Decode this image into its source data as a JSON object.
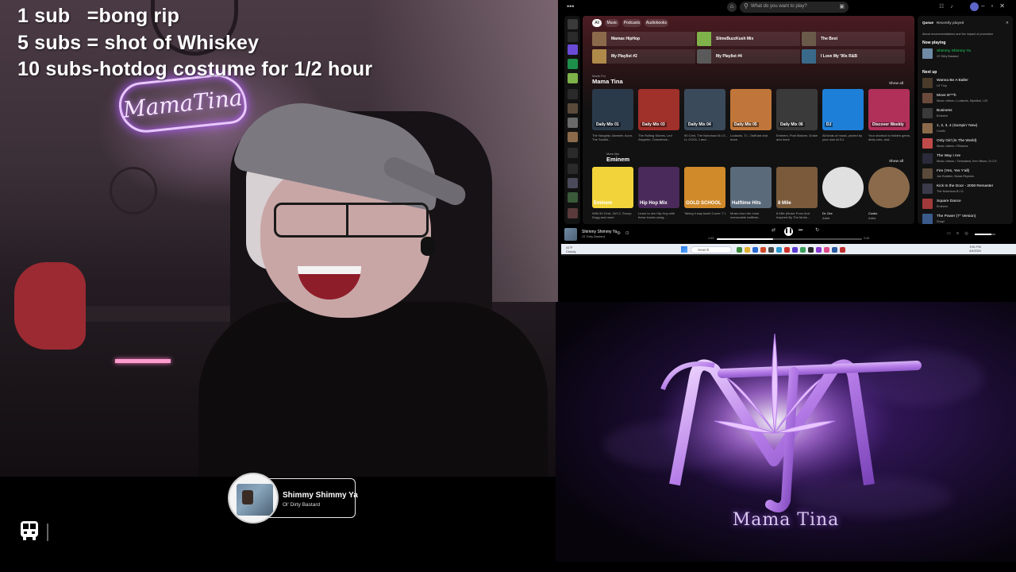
{
  "overlay": {
    "sub_goals": [
      "1 sub   =bong rip",
      "5 subs = shot of Whiskey",
      "10 subs-hotdog costume for 1/2 hour"
    ],
    "neon_sign": "MamaTina",
    "now_playing": {
      "title": "Shimmy Shimmy Ya",
      "artist": "Ol' Dirty Bastard"
    }
  },
  "spotify": {
    "search_placeholder": "What do you want to play?",
    "chips": [
      "All",
      "Music",
      "Podcasts",
      "Audiobooks"
    ],
    "quick_picks": [
      {
        "label": "Mamas HipHop",
        "color": "#8a6a4a"
      },
      {
        "label": "SlimeBuzzKush Mix",
        "color": "#7fb24a"
      },
      {
        "label": "The Best",
        "color": "#6a5a4a"
      },
      {
        "label": "My Playlist #2",
        "color": "#b08a4a"
      },
      {
        "label": "My Playlist #4",
        "color": "#5a5a5a"
      },
      {
        "label": "I Love My '90s R&B",
        "color": "#3a6a8a"
      }
    ],
    "made_for": {
      "kicker": "Made For",
      "title": "Mama Tina",
      "show_all": "Show all",
      "cards": [
        {
          "badge": "Daily Mix 01",
          "caption": "The Naughty Jokester, Avon, The Soulful...",
          "color": "#2b3a4a"
        },
        {
          "badge": "Daily Mix 03",
          "caption": "The Rolling Stones, Led Zeppelin, Creedence...",
          "color": "#a0302a"
        },
        {
          "badge": "Daily Mix 04",
          "caption": "50 Cent, The Notorious B.I.G., LL COOL J and...",
          "color": "#3a4a5a"
        },
        {
          "badge": "Daily Mix 05",
          "caption": "Ludacris, T.I., OutKast and more",
          "color": "#c0763a"
        },
        {
          "badge": "Daily Mix 06",
          "caption": "Eminem, Post Malone, Drake and more",
          "color": "#3a3a3a"
        },
        {
          "badge": "DJ",
          "caption": "All kinds of music, picked by your own AI DJ.",
          "color": "#1e7fd8"
        },
        {
          "badge": "Discover Weekly",
          "caption": "Your shortcut to hidden gems, deep cuts, and...",
          "color": "#b0305a"
        }
      ]
    },
    "more_like": {
      "kicker": "More like",
      "title": "Eminem",
      "show_all": "Show all",
      "cards": [
        {
          "big": "Eminem",
          "caption": "With 50 Cent, JAY-Z, Snoop Dogg and more",
          "color": "#f2d43a",
          "round": false
        },
        {
          "big": "Hip Hop Mix",
          "caption": "Learn to mix Hip-Hop with these tracks using...",
          "color": "#4a2a5a",
          "round": false
        },
        {
          "big": "GOLD SCHOOL",
          "caption": "Taking it way back! Cover: T.I.",
          "color": "#d08a2a",
          "round": false
        },
        {
          "big": "Halftime Hits",
          "caption": "Music from the most memorable halftime...",
          "color": "#5a6a7a",
          "round": false
        },
        {
          "big": "8 Mile",
          "caption": "8 Mile (Music From And Inspired By The Motio...",
          "color": "#7a5a3a",
          "round": false
        },
        {
          "big": "",
          "caption": "Dr. Dre",
          "sub": "Artist",
          "color": "#e0e0e0",
          "round": true
        },
        {
          "big": "",
          "caption": "Coolio",
          "sub": "Artist",
          "color": "#8a6a4a",
          "round": true
        }
      ]
    },
    "queue": {
      "tabs": [
        "Queue",
        "Recently played"
      ],
      "note": "About recommendations and the impact of promotion",
      "now_playing_label": "Now playing",
      "now_playing": {
        "title": "Shimmy Shimmy Ya",
        "artist": "Ol' Dirty Bastard"
      },
      "next_up_label": "Next up",
      "items": [
        {
          "title": "Wanna Be A Baller",
          "artist": "Lil' Troy",
          "color": "#4a3a2a"
        },
        {
          "title": "Move B***h",
          "artist": "Music videos • Ludacris, Mystikal, I-20",
          "color": "#6a4a3a"
        },
        {
          "title": "Business",
          "artist": "Eminem",
          "color": "#3a3a3a"
        },
        {
          "title": "1, 2, 3, 4 (Sumpin' New)",
          "artist": "Coolio",
          "color": "#8a6a4a"
        },
        {
          "title": "Only Girl (In The World)",
          "artist": "Music videos • Rihanna",
          "color": "#c04a4a"
        },
        {
          "title": "The Way I Are",
          "artist": "Music videos • Timbaland, Keri Hilson, D.O.E.",
          "color": "#2a2a3a"
        },
        {
          "title": "Fire (Yes, Yes Y'all)",
          "artist": "Joe Budden, Busta Rhymes",
          "color": "#5a4a3a"
        },
        {
          "title": "Kick In the Door - 2008 Remaster",
          "artist": "The Notorious B.I.G.",
          "color": "#3a3a4a"
        },
        {
          "title": "Square Dance",
          "artist": "Eminem",
          "color": "#a03a3a"
        },
        {
          "title": "The Power (7\" Version)",
          "artist": "Snap!",
          "color": "#3a5a8a"
        }
      ]
    },
    "player": {
      "title": "Shimmy Shimmy Ya",
      "artist": "Ol' Dirty Bastard",
      "elapsed": "1:03",
      "duration": "2:42",
      "progress": 0.39,
      "volume": 0.8
    },
    "taskbar": {
      "weather_temp": "41°F",
      "weather_desc": "Cloudy",
      "search": "Search",
      "time": "9:51 PM",
      "date": "4/4/2024"
    }
  },
  "logo": {
    "brand": "Mama Tina"
  },
  "colors": {
    "spotify_green": "#1ed760",
    "neon_purple": "#b35cff",
    "logo_purple": "#c792ff"
  }
}
